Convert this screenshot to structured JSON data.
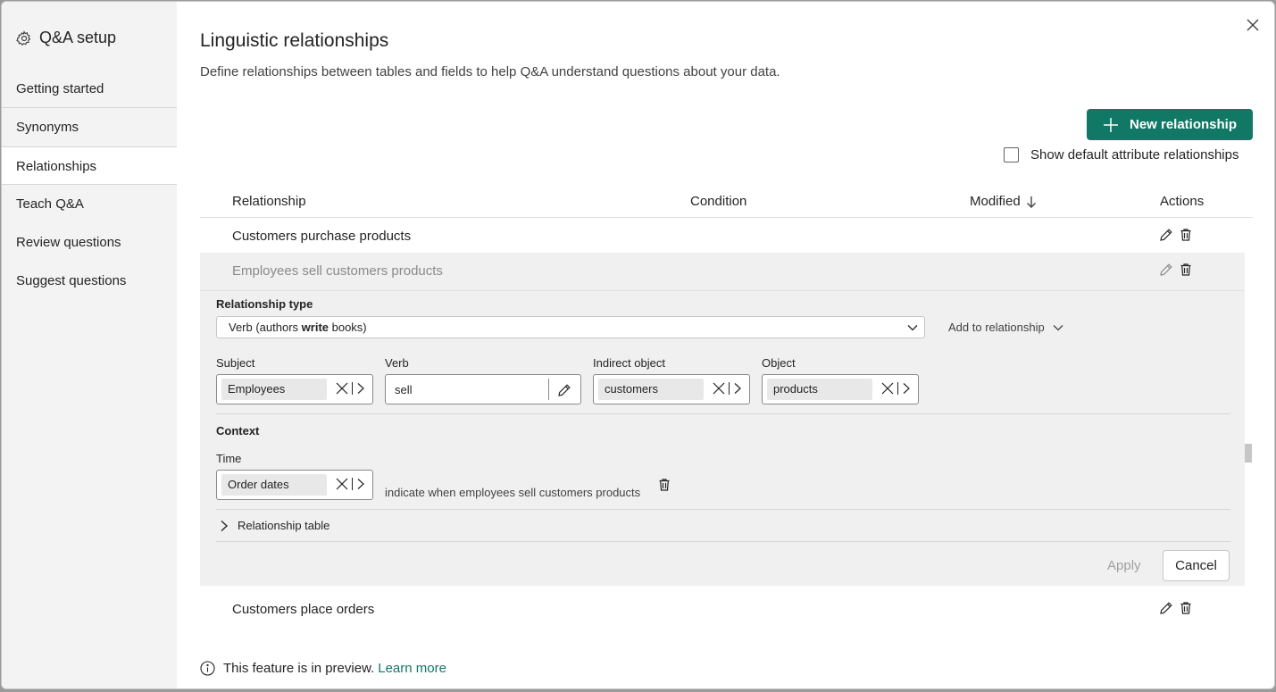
{
  "sidebar": {
    "title": "Q&A setup",
    "items": [
      {
        "label": "Getting started"
      },
      {
        "label": "Synonyms"
      },
      {
        "label": "Relationships"
      },
      {
        "label": "Teach Q&A"
      },
      {
        "label": "Review questions"
      },
      {
        "label": "Suggest questions"
      }
    ],
    "active_index": 2
  },
  "main": {
    "title": "Linguistic relationships",
    "description": "Define relationships between tables and fields to help Q&A understand questions about your data.",
    "new_relationship_label": "New relationship",
    "show_default_label": "Show default attribute relationships",
    "show_default_checked": false,
    "table": {
      "headers": {
        "relationship": "Relationship",
        "condition": "Condition",
        "modified": "Modified",
        "actions": "Actions"
      },
      "rows": [
        {
          "relationship": "Customers purchase products"
        },
        {
          "relationship": "Employees sell customers products"
        },
        {
          "relationship": "Customers place orders"
        }
      ]
    },
    "editor": {
      "relationship_type_label": "Relationship type",
      "relationship_type_value_pre": "Verb (authors ",
      "relationship_type_value_bold": "write",
      "relationship_type_value_post": " books)",
      "add_to_relationship": "Add to relationship",
      "subject_label": "Subject",
      "subject_value": "Employees",
      "verb_label": "Verb",
      "verb_value": "sell",
      "indirect_object_label": "Indirect object",
      "indirect_object_value": "customers",
      "object_label": "Object",
      "object_value": "products",
      "context_label": "Context",
      "time_label": "Time",
      "time_value": "Order dates",
      "time_description": "indicate when employees sell customers products",
      "relationship_table_label": "Relationship table",
      "apply_label": "Apply",
      "cancel_label": "Cancel"
    },
    "preview_text": "This feature is in preview.",
    "learn_more": "Learn more"
  },
  "colors": {
    "accent": "#117865",
    "sidebar_bg": "#f3f3f3",
    "expanded_bg": "#f0f0f0"
  }
}
